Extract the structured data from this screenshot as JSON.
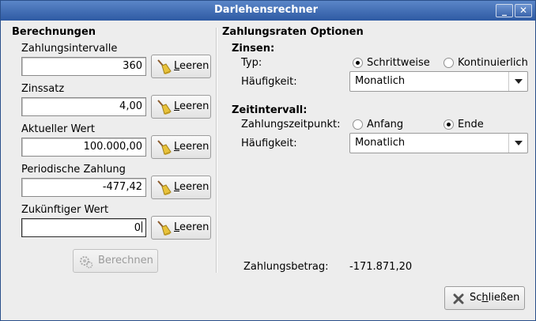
{
  "window": {
    "title": "Darlehensrechner"
  },
  "left": {
    "title": "Berechnungen",
    "fields": [
      {
        "label": "Zahlungsintervalle",
        "value": "360"
      },
      {
        "label": "Zinssatz",
        "value": "4,00"
      },
      {
        "label": "Aktueller Wert",
        "value": "100.000,00"
      },
      {
        "label": "Periodische Zahlung",
        "value": "-477,42"
      },
      {
        "label": "Zukünftiger Wert",
        "value": "0"
      }
    ],
    "clear_label_prefix": "L",
    "clear_label_rest": "eeren",
    "calculate_label": "Berechnen"
  },
  "right": {
    "title": "Zahlungsraten Optionen",
    "interest": {
      "title": "Zinsen:",
      "type_label": "Typ:",
      "option_a": "Schrittweise",
      "option_b": "Kontinuierlich",
      "selected": "Schrittweise",
      "frequency_label": "Häufigkeit:",
      "frequency_value": "Monatlich"
    },
    "period": {
      "title": "Zeitintervall:",
      "timing_label": "Zahlungszeitpunkt:",
      "option_a": "Anfang",
      "option_b": "Ende",
      "selected": "Ende",
      "frequency_label": "Häufigkeit:",
      "frequency_value": "Monatlich"
    },
    "amount_label": "Zahlungsbetrag:",
    "amount_value": "-171.871,20"
  },
  "close_button": {
    "prefix": "Sc",
    "underline": "h",
    "rest": "ließen"
  }
}
